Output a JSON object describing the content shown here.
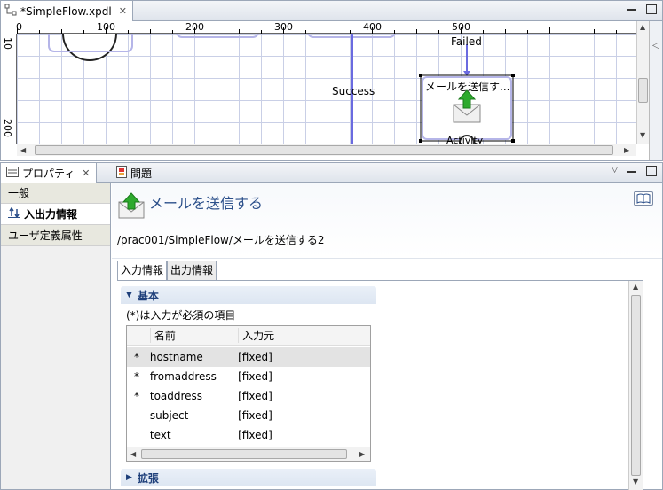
{
  "editor": {
    "tab_title": "*SimpleFlow.xpdl",
    "ruler_h": [
      "0",
      "100",
      "200",
      "300",
      "400",
      "500"
    ],
    "ruler_v": [
      "10",
      "200"
    ],
    "labels": {
      "failed": "Failed",
      "success": "Success",
      "node_title": "メールを送信す...",
      "node_sub": "Activity"
    }
  },
  "properties": {
    "tab_label": "プロパティ",
    "problems_label": "問題",
    "sidebar": [
      {
        "label": "一般"
      },
      {
        "label": "入出力情報"
      },
      {
        "label": "ユーザ定義属性"
      }
    ],
    "title": "メールを送信する",
    "path": "/prac001/SimpleFlow/メールを送信する2",
    "subtabs": [
      "入力情報",
      "出力情報"
    ],
    "section_basic": "基本",
    "required_note": "(*)は入力が必須の項目",
    "table": {
      "headers": [
        "名前",
        "入力元"
      ],
      "rows": [
        {
          "req": "*",
          "name": "hostname",
          "src": "[fixed]"
        },
        {
          "req": "*",
          "name": "fromaddress",
          "src": "[fixed]"
        },
        {
          "req": "*",
          "name": "toaddress",
          "src": "[fixed]"
        },
        {
          "req": "",
          "name": "subject",
          "src": "[fixed]"
        },
        {
          "req": "",
          "name": "text",
          "src": "[fixed]"
        }
      ]
    },
    "section_ext": "拡張"
  },
  "colors": {
    "accent": "#2b4f8a",
    "flow_line": "#6a6ae0"
  }
}
